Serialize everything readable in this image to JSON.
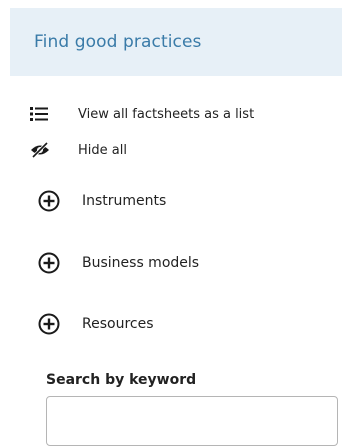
{
  "header": {
    "title": "Find good practices"
  },
  "links": {
    "view_list": "View all factsheets as a list",
    "hide_all": "Hide all"
  },
  "accordion": {
    "items": [
      {
        "label": "Instruments"
      },
      {
        "label": "Business models"
      },
      {
        "label": "Resources"
      }
    ]
  },
  "search": {
    "label": "Search by keyword",
    "value": "",
    "placeholder": ""
  },
  "colors": {
    "header_bg": "#e7f0f7",
    "title_blue": "#3a7ba8"
  },
  "icons": {
    "list": "list-icon",
    "hide": "eye-slash-icon",
    "expand": "plus-circle-icon"
  }
}
